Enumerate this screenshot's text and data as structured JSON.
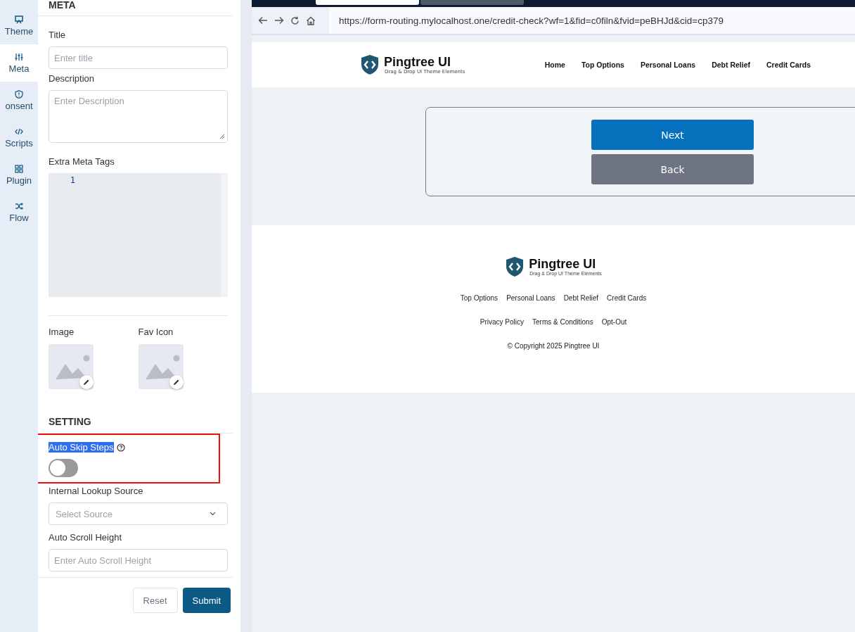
{
  "side_nav": [
    {
      "label": "Theme",
      "selected": false
    },
    {
      "label": "Meta",
      "selected": true
    },
    {
      "label": "onsent",
      "selected": false
    },
    {
      "label": "Scripts",
      "selected": false
    },
    {
      "label": "Plugin",
      "selected": false
    },
    {
      "label": "Flow",
      "selected": false
    }
  ],
  "panel": {
    "heading": "META",
    "fields": [
      {
        "kind": "input",
        "label": "Title",
        "placeholder": "Enter title"
      },
      {
        "kind": "textarea",
        "label": "Description",
        "placeholder": "Enter Description"
      },
      {
        "kind": "code",
        "label": "Extra Meta Tags",
        "line_number": "1"
      }
    ],
    "images": [
      {
        "label": "Image"
      },
      {
        "label": "Fav Icon"
      }
    ],
    "setting_heading": "SETTING",
    "toggle": {
      "label": "Auto Skip Steps",
      "on": false,
      "text_selected": true,
      "annotated": true
    },
    "setting_fields": [
      {
        "kind": "select",
        "label": "Internal Lookup Source",
        "placeholder": "Select Source"
      },
      {
        "kind": "input",
        "label": "Auto Scroll Height",
        "placeholder": "Enter Auto Scroll Height"
      }
    ],
    "buttons": [
      {
        "label": "Reset",
        "kind": "secondary"
      },
      {
        "label": "Submit",
        "kind": "primary"
      }
    ]
  },
  "browser": {
    "tabs": [
      {
        "selected": true
      },
      {
        "selected": false
      }
    ],
    "url": "https://form-routing.mylocalhost.one/credit-check?wf=1&fid=c0filn&fvid=peBHJd&cid=cp379",
    "site": {
      "logo_name": "Pingtree UI",
      "logo_tagline": "Drag & Drop UI Theme Elements",
      "nav": [
        "Home",
        "Top Options",
        "Personal Loans",
        "Debt Relief",
        "Credit Cards"
      ],
      "form_buttons": [
        {
          "label": "Next",
          "kind": "primary"
        },
        {
          "label": "Back",
          "kind": "secondary"
        }
      ],
      "footer": {
        "logo_name": "Pingtree UI",
        "logo_tagline": "Drag & Drop UI Theme Elements",
        "links": [
          "Top Options",
          "Personal Loans",
          "Debt Relief",
          "Credit Cards"
        ],
        "legal_links": [
          "Privacy Policy",
          "Terms & Conditions",
          "Opt-Out"
        ],
        "copyright": "© Copyright 2025 Pingtree UI"
      }
    }
  }
}
